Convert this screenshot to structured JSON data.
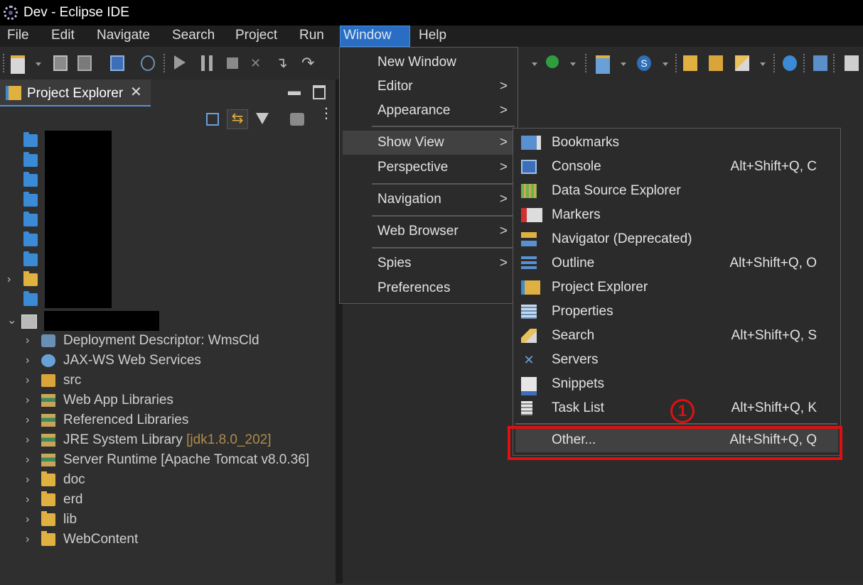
{
  "window": {
    "title": "Dev - Eclipse IDE",
    "icon": "eclipse-icon"
  },
  "menubar": {
    "items": [
      {
        "label": "File"
      },
      {
        "label": "Edit"
      },
      {
        "label": "Navigate"
      },
      {
        "label": "Search"
      },
      {
        "label": "Project"
      },
      {
        "label": "Run"
      },
      {
        "label": "Window",
        "active": true
      },
      {
        "label": "Help"
      }
    ]
  },
  "project_explorer": {
    "tab_label": "Project Explorer",
    "tree": [
      {
        "label": "Deployment Descriptor: WmsCld",
        "icon": "deployment-descriptor-icon"
      },
      {
        "label": "JAX-WS Web Services",
        "icon": "web-services-icon"
      },
      {
        "label": "src",
        "icon": "source-folder-icon"
      },
      {
        "label": "Web App Libraries",
        "icon": "library-icon"
      },
      {
        "label": "Referenced Libraries",
        "icon": "library-icon"
      },
      {
        "label": "JRE System Library",
        "decoration": "[jdk1.8.0_202]",
        "icon": "library-icon"
      },
      {
        "label": "Server Runtime [Apache Tomcat v8.0.36]",
        "icon": "library-icon"
      },
      {
        "label": "doc",
        "icon": "folder-icon"
      },
      {
        "label": "erd",
        "icon": "folder-icon"
      },
      {
        "label": "lib",
        "icon": "folder-icon"
      },
      {
        "label": "WebContent",
        "icon": "folder-icon"
      }
    ]
  },
  "window_menu": {
    "items": [
      {
        "label": "New Window",
        "submenu": false
      },
      {
        "label": "Editor",
        "submenu": true,
        "arrow": ">"
      },
      {
        "label": "Appearance",
        "submenu": true,
        "arrow": ">"
      },
      {
        "label": "Show View",
        "submenu": true,
        "arrow": ">",
        "highlighted": true
      },
      {
        "label": "Perspective",
        "submenu": true,
        "arrow": ">"
      },
      {
        "label": "Navigation",
        "submenu": true,
        "arrow": ">"
      },
      {
        "label": "Web Browser",
        "submenu": true,
        "arrow": ">"
      },
      {
        "label": "Spies",
        "submenu": true,
        "arrow": ">"
      },
      {
        "label": "Preferences",
        "submenu": false
      }
    ]
  },
  "show_view_menu": {
    "items": [
      {
        "label": "Bookmarks",
        "shortcut": "",
        "icon": "bookmarks-icon"
      },
      {
        "label": "Console",
        "shortcut": "Alt+Shift+Q, C",
        "icon": "console-icon"
      },
      {
        "label": "Data Source Explorer",
        "shortcut": "",
        "icon": "data-source-icon"
      },
      {
        "label": "Markers",
        "shortcut": "",
        "icon": "markers-icon"
      },
      {
        "label": "Navigator (Deprecated)",
        "shortcut": "",
        "icon": "navigator-icon"
      },
      {
        "label": "Outline",
        "shortcut": "Alt+Shift+Q, O",
        "icon": "outline-icon"
      },
      {
        "label": "Project Explorer",
        "shortcut": "",
        "icon": "project-explorer-icon"
      },
      {
        "label": "Properties",
        "shortcut": "",
        "icon": "properties-icon"
      },
      {
        "label": "Search",
        "shortcut": "Alt+Shift+Q, S",
        "icon": "search-icon"
      },
      {
        "label": "Servers",
        "shortcut": "",
        "icon": "servers-icon"
      },
      {
        "label": "Snippets",
        "shortcut": "",
        "icon": "snippets-icon"
      },
      {
        "label": "Task List",
        "shortcut": "Alt+Shift+Q, K",
        "icon": "task-list-icon"
      },
      {
        "label": "Other...",
        "shortcut": "Alt+Shift+Q, Q",
        "highlighted": true
      }
    ]
  },
  "annotation": {
    "step_marker": "①",
    "color": "#e01010"
  },
  "colors": {
    "accent": "#2a6ec4",
    "menu_bg": "#2b2b2b",
    "highlight": "#414141",
    "decoration": "#b08b4a"
  }
}
